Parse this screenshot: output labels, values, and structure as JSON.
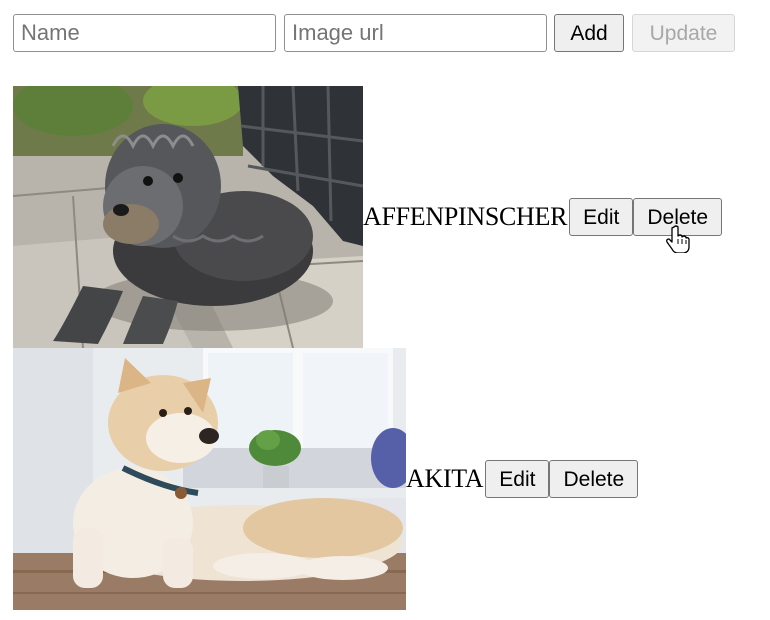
{
  "form": {
    "name_placeholder": "Name",
    "image_url_placeholder": "Image url",
    "add_label": "Add",
    "update_label": "Update"
  },
  "breeds": [
    {
      "name": "AFFENPINSCHER",
      "image_description": "shaggy grey dog lying on paving stones",
      "edit_label": "Edit",
      "delete_label": "Delete"
    },
    {
      "name": "AKITA",
      "image_description": "cream and white akita lying on wooden floor",
      "edit_label": "Edit",
      "delete_label": "Delete"
    }
  ],
  "colors": {
    "button_bg": "#efefef",
    "button_border": "#767676",
    "disabled_text": "#a8a8a8"
  }
}
